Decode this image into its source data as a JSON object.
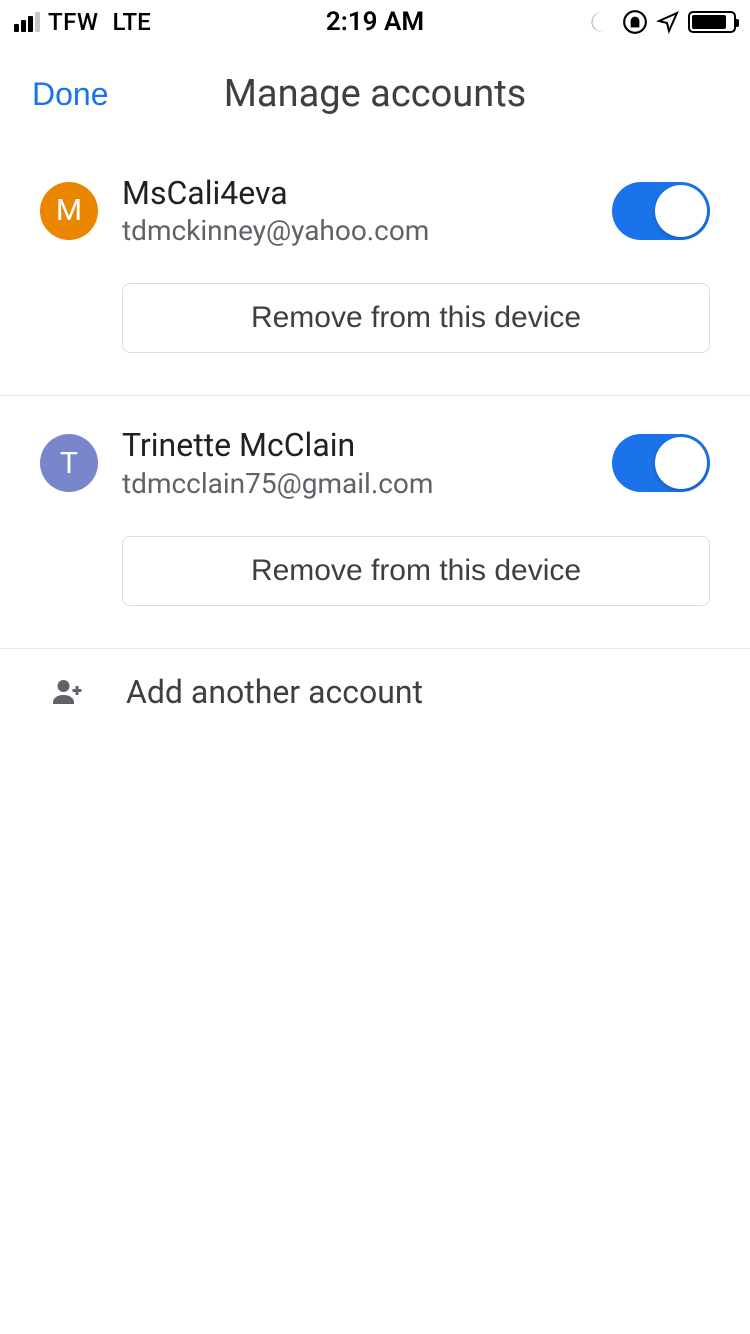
{
  "status_bar": {
    "carrier": "TFW",
    "network": "LTE",
    "time": "2:19 AM"
  },
  "header": {
    "done_label": "Done",
    "title": "Manage accounts"
  },
  "accounts": [
    {
      "initial": "M",
      "name": "MsCali4eva",
      "email": "tdmckinney@yahoo.com",
      "avatar_color": "#ea8600",
      "enabled": true,
      "remove_label": "Remove from this device"
    },
    {
      "initial": "T",
      "name": "Trinette McClain",
      "email": "tdmcclain75@gmail.com",
      "avatar_color": "#7986cb",
      "enabled": true,
      "remove_label": "Remove from this device"
    }
  ],
  "add_account": {
    "label": "Add another account"
  }
}
